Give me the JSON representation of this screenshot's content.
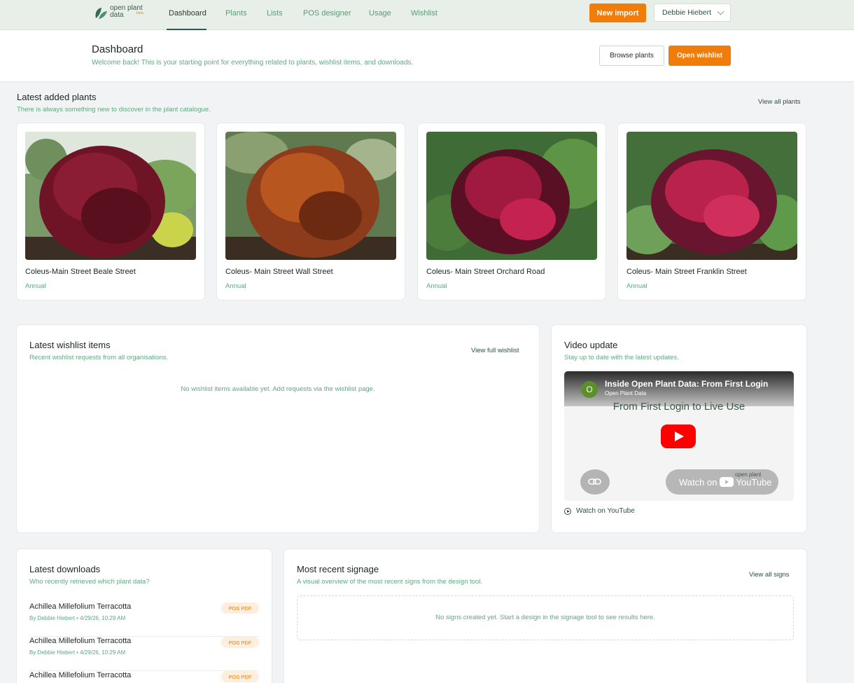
{
  "brand": {
    "name": "open plant data",
    "beta_label": "beta"
  },
  "nav": {
    "items": [
      {
        "label": "Dashboard",
        "active": true
      },
      {
        "label": "Plants"
      },
      {
        "label": "Lists"
      },
      {
        "label": "POS designer"
      },
      {
        "label": "Usage"
      },
      {
        "label": "Wishlist"
      }
    ],
    "new_import": "New import",
    "user": "Debbie Hiebert"
  },
  "header": {
    "title": "Dashboard",
    "subtitle": "Welcome back! This is your starting point for everything related to plants, wishlist items, and downloads.",
    "browse_plants": "Browse plants",
    "open_wishlist": "Open wishlist"
  },
  "latest_plants": {
    "title": "Latest added plants",
    "subtitle": "There is always something new to discover in the plant catalogue.",
    "view_all": "View all plants",
    "items": [
      {
        "name": "Coleus-Main Street Beale Street",
        "type": "Annual"
      },
      {
        "name": "Coleus- Main Street Wall Street",
        "type": "Annual"
      },
      {
        "name": "Coleus- Main Street Orchard Road",
        "type": "Annual"
      },
      {
        "name": "Coleus- Main Street Franklin Street",
        "type": "Annual"
      }
    ]
  },
  "wishlist": {
    "title": "Latest wishlist items",
    "subtitle": "Recent wishlist requests from all organisations.",
    "view_full": "View full wishlist",
    "empty": "No wishlist items available yet. Add requests via the wishlist page."
  },
  "video": {
    "title": "Video update",
    "subtitle": "Stay up to date with the latest updates.",
    "yt_title": "Inside Open Plant Data: From First Login",
    "yt_channel": "Open Plant Data",
    "yt_avatar": "O",
    "thumb_text": "From First Login to Live Use",
    "watch_on": "Watch on",
    "youtube": "YouTube",
    "watermark": "open plant",
    "watch_link": "Watch on YouTube"
  },
  "downloads": {
    "title": "Latest downloads",
    "subtitle": "Who recently retrieved which plant data?",
    "items": [
      {
        "name": "Achillea Millefolium Terracotta",
        "meta": "By Debbie Hiebert • 4/29/26, 10:29 AM",
        "badge": "POS PDF"
      },
      {
        "name": "Achillea Millefolium Terracotta",
        "meta": "By Debbie Hiebert • 4/29/26, 10:29 AM",
        "badge": "POS PDF"
      },
      {
        "name": "Achillea Millefolium Terracotta",
        "meta": "",
        "badge": "POS PDF"
      }
    ]
  },
  "signage": {
    "title": "Most recent signage",
    "subtitle": "A visual overview of the most recent signs from the design tool.",
    "view_all": "View all signs",
    "empty": "No signs created yet. Start a design in the signage tool to see results here."
  }
}
